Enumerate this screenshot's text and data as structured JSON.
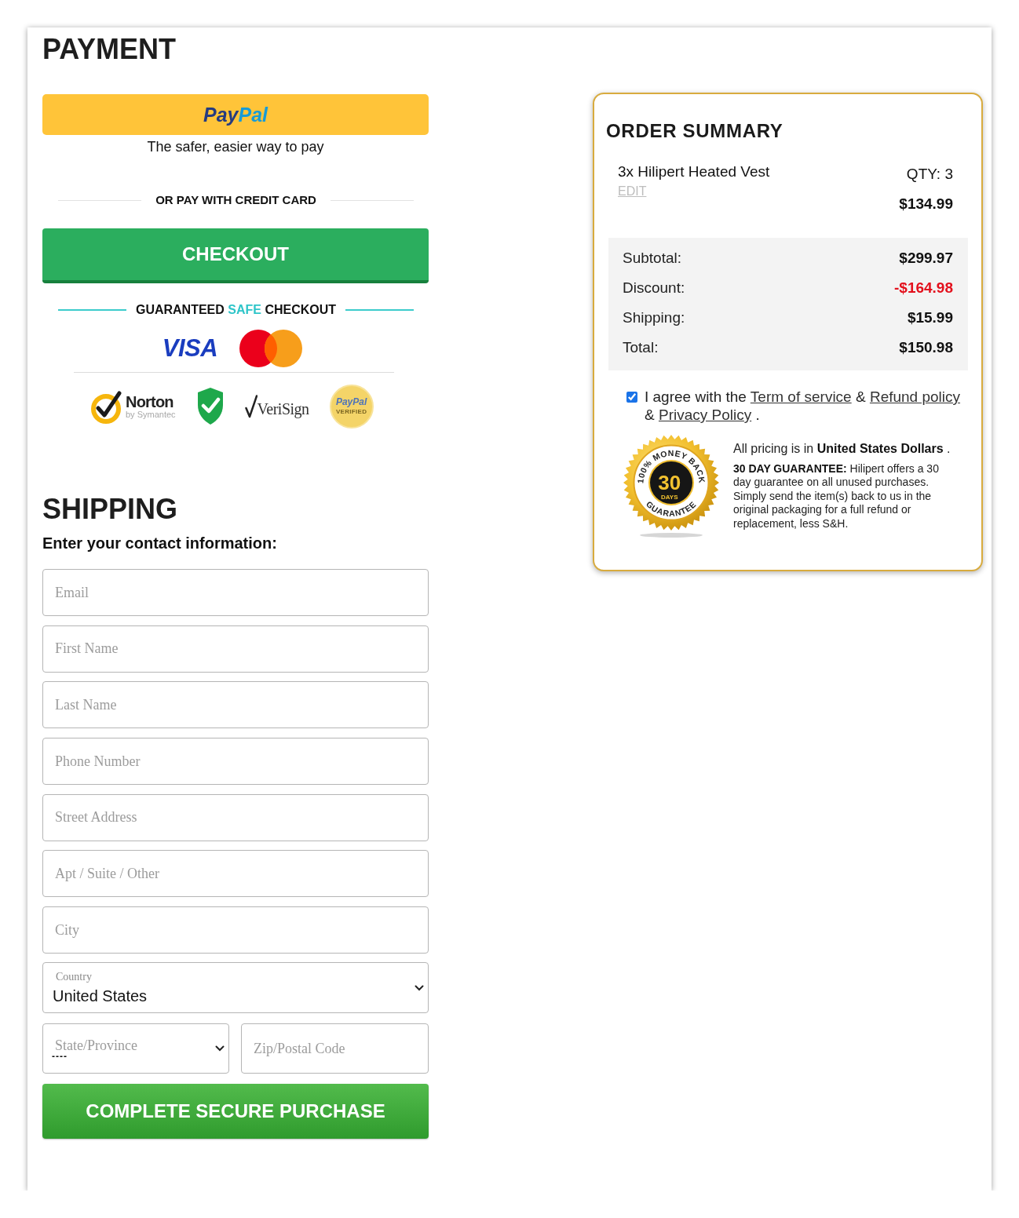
{
  "payment": {
    "title": "PAYMENT",
    "paypal_button": {
      "logo_parts": [
        "Pay",
        "Pal"
      ]
    },
    "paypal_tagline": "The safer, easier way to pay",
    "divider_label": "OR PAY WITH CREDIT CARD",
    "checkout_button": "CHECKOUT",
    "safe_checkout": [
      {
        "text": "GUARANTEED",
        "accent": false
      },
      {
        "text": "SAFE",
        "accent": true
      },
      {
        "text": "CHECKOUT",
        "accent": false
      }
    ],
    "card_logos": [
      {
        "kind": "visa",
        "text": "VISA"
      },
      {
        "kind": "mastercard"
      }
    ],
    "trust_badges": [
      {
        "kind": "norton",
        "name": "Norton",
        "tagline": "by Symantec"
      },
      {
        "kind": "shield"
      },
      {
        "kind": "verisign",
        "name": "VeriSign"
      },
      {
        "kind": "paypal_verified",
        "name": "PayPal",
        "tagline": "VERIFIED"
      }
    ]
  },
  "shipping": {
    "title": "SHIPPING",
    "subtitle": "Enter your contact information:",
    "fields": [
      {
        "placeholder": "Email"
      },
      {
        "placeholder": "First Name"
      },
      {
        "placeholder": "Last Name"
      },
      {
        "placeholder": "Phone Number"
      },
      {
        "placeholder": "Street Address"
      },
      {
        "placeholder": "Apt / Suite / Other"
      },
      {
        "placeholder": "City"
      }
    ],
    "country": {
      "label": "Country",
      "value": "United States"
    },
    "state": {
      "placeholder": "State/Province",
      "value": "----"
    },
    "zip": {
      "placeholder": "Zip/Postal Code"
    },
    "submit_button": "COMPLETE SECURE PURCHASE"
  },
  "order_summary": {
    "title": "ORDER SUMMARY",
    "items": [
      {
        "name": "3x Hilipert Heated Vest",
        "edit": "EDIT",
        "qty": "QTY: 3",
        "price": "$134.99"
      }
    ],
    "totals": [
      {
        "label": "Subtotal:",
        "value": "$299.97",
        "kind": "amount"
      },
      {
        "label": "Discount:",
        "value": "-$164.98",
        "kind": "discount"
      },
      {
        "label": "Shipping:",
        "value": "$15.99",
        "kind": "amount"
      },
      {
        "label": "Total:",
        "value": "$150.98",
        "kind": "amount"
      }
    ],
    "agreement": {
      "checked": true,
      "parts": [
        {
          "kind": "text",
          "text": "I agree with the "
        },
        {
          "kind": "link",
          "text": "Term of service"
        },
        {
          "kind": "text",
          "text": " & "
        },
        {
          "kind": "link",
          "text": "Refund policy"
        },
        {
          "kind": "text",
          "text": " & "
        },
        {
          "kind": "link",
          "text": "Privacy Policy"
        },
        {
          "kind": "text",
          "text": " ."
        }
      ]
    },
    "seal": {
      "top": "100% MONEY BACK",
      "number": "30",
      "unit": "DAYS",
      "bottom": "GUARANTEE"
    },
    "currency_note": "All pricing is in **United States Dollars** .",
    "guarantee_text": "**30 DAY GUARANTEE:** Hilipert offers a 30 day guarantee on all unused purchases. Simply send the item(s) back to us in the original packaging for a full refund or replacement, less S&H."
  }
}
